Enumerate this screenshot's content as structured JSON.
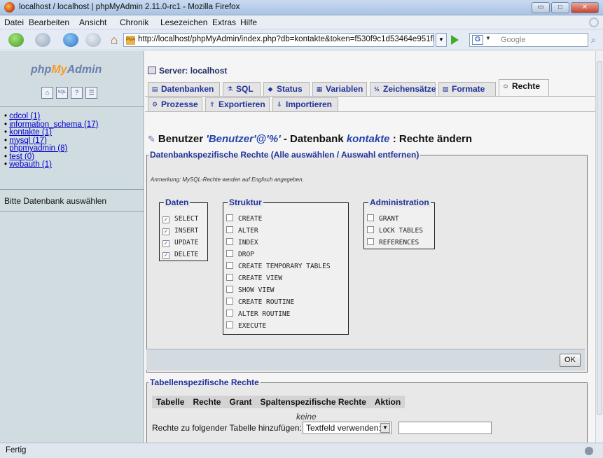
{
  "window": {
    "title": "localhost / localhost | phpMyAdmin 2.11.0-rc1 - Mozilla Firefox",
    "minimize": "▭",
    "maximize": "□",
    "close": "✕"
  },
  "menu": [
    "Datei",
    "Bearbeiten",
    "Ansicht",
    "Chronik",
    "Lesezeichen",
    "Extras",
    "Hilfe"
  ],
  "toolbar": {
    "url": "http://localhost/phpMyAdmin/index.php?db=kontakte&token=f530f9c1d53464e951fl",
    "favicon": "PMA",
    "search_engine_letter": "G",
    "search_placeholder": "Google"
  },
  "sidebar": {
    "logo": {
      "php": "php",
      "my": "My",
      "admin": "Admin"
    },
    "icons": [
      "home-icon",
      "sql-icon",
      "help-icon",
      "docs-icon"
    ],
    "icon_glyphs": [
      "⌂",
      "SQL",
      "?",
      "☰"
    ],
    "databases": [
      "cdcol (1)",
      "information_schema (17)",
      "kontakte (1)",
      "mysql (17)",
      "phpmyadmin (8)",
      "test (0)",
      "webauth (1)"
    ],
    "hint": "Bitte Datenbank auswählen"
  },
  "main": {
    "server_label": "Server: localhost",
    "tabs_row1": [
      {
        "label": "Datenbanken",
        "icon": "database-icon",
        "glyph": "▤"
      },
      {
        "label": "SQL",
        "icon": "sql-icon",
        "glyph": "⚗"
      },
      {
        "label": "Status",
        "icon": "status-icon",
        "glyph": "◆"
      },
      {
        "label": "Variablen",
        "icon": "variables-icon",
        "glyph": "▦"
      },
      {
        "label": "Zeichensätze",
        "icon": "charset-icon",
        "glyph": "½"
      },
      {
        "label": "Formate",
        "icon": "engines-icon",
        "glyph": "▧"
      },
      {
        "label": "Rechte",
        "icon": "privileges-icon",
        "glyph": "☺"
      }
    ],
    "tabs_row2": [
      {
        "label": "Prozesse",
        "icon": "processes-icon",
        "glyph": "⚙"
      },
      {
        "label": "Exportieren",
        "icon": "export-icon",
        "glyph": "⇪"
      },
      {
        "label": "Importieren",
        "icon": "import-icon",
        "glyph": "⇩"
      }
    ],
    "heading": {
      "prefix": "Benutzer ",
      "user": "'Benutzer'@'%'",
      "middle": " - Datenbank ",
      "database": "kontakte",
      "suffix": " : Rechte ändern"
    },
    "db_privs_legend": "Datenbankspezifische Rechte (Alle auswählen / Auswahl entfernen)",
    "note": "Anmerkung: MySQL-Rechte werden auf Englisch angegeben.",
    "groups": {
      "daten": {
        "title": "Daten",
        "items": [
          {
            "label": "SELECT",
            "checked": true
          },
          {
            "label": "INSERT",
            "checked": true
          },
          {
            "label": "UPDATE",
            "checked": true
          },
          {
            "label": "DELETE",
            "checked": true
          }
        ]
      },
      "struktur": {
        "title": "Struktur",
        "items": [
          {
            "label": "CREATE",
            "checked": false
          },
          {
            "label": "ALTER",
            "checked": false
          },
          {
            "label": "INDEX",
            "checked": false
          },
          {
            "label": "DROP",
            "checked": false
          },
          {
            "label": "CREATE TEMPORARY TABLES",
            "checked": false
          },
          {
            "label": "CREATE VIEW",
            "checked": false
          },
          {
            "label": "SHOW VIEW",
            "checked": false
          },
          {
            "label": "CREATE ROUTINE",
            "checked": false
          },
          {
            "label": "ALTER ROUTINE",
            "checked": false
          },
          {
            "label": "EXECUTE",
            "checked": false
          }
        ]
      },
      "administration": {
        "title": "Administration",
        "items": [
          {
            "label": "GRANT",
            "checked": false
          },
          {
            "label": "LOCK TABLES",
            "checked": false
          },
          {
            "label": "REFERENCES",
            "checked": false
          }
        ]
      }
    },
    "ok_label": "OK",
    "table_privs_legend": "Tabellenspezifische Rechte",
    "table_columns": [
      "Tabelle",
      "Rechte",
      "Grant",
      "Spaltenspezifische Rechte",
      "Aktion"
    ],
    "empty_text": "keine",
    "add_label": "Rechte zu folgender Tabelle hinzufügen:",
    "add_select_value": "Textfeld verwenden:"
  },
  "status": {
    "text": "Fertig"
  }
}
